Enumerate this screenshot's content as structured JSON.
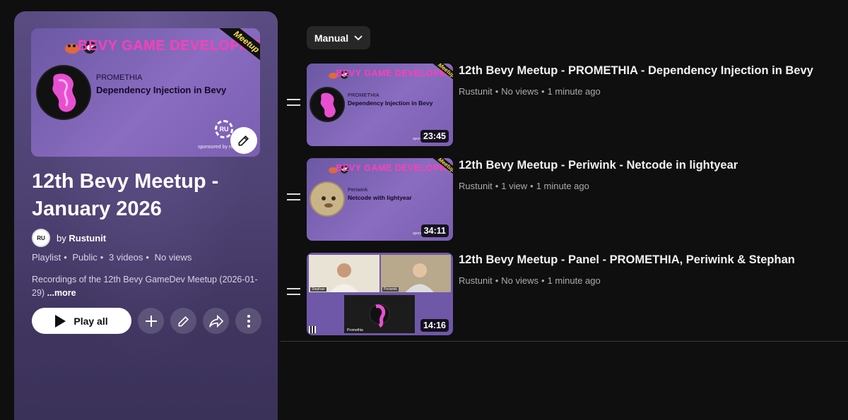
{
  "playlist": {
    "title": "12th Bevy Meetup - January 2026",
    "owner_prefix": "by",
    "owner_name": "Rustunit",
    "avatar_text": "RU",
    "meta": [
      "Playlist",
      "Public",
      "3 videos",
      "No views"
    ],
    "description": "Recordings of the 12th Bevy GameDev Meetup (2026-01-29)",
    "more_label": "...more",
    "play_all_label": "Play all",
    "hero": {
      "banner": "BEVY GAME DEVELOPMENT",
      "ribbon": "Meetup",
      "speaker": "PROMETHIA",
      "topic": "Dependency Injection in Bevy",
      "logo": "RU",
      "sponsor": "sponsored by rustunit"
    }
  },
  "sort": {
    "label": "Manual"
  },
  "videos": [
    {
      "title": "12th Bevy Meetup - PROMETHIA - Dependency Injection in Bevy",
      "channel": "Rustunit",
      "views": "No views",
      "age": "1 minute ago",
      "duration": "23:45",
      "thumb": {
        "banner": "BEVY GAME DEVELOPMENT",
        "ribbon": "Meetup",
        "speaker": "PROMETHIA",
        "topic": "Dependency Injection in Bevy",
        "sponsor": "sponsored by"
      }
    },
    {
      "title": "12th Bevy Meetup - Periwink - Netcode in lightyear",
      "channel": "Rustunit",
      "views": "1 view",
      "age": "1 minute ago",
      "duration": "34:11",
      "thumb": {
        "banner": "BEVY GAME DEVELOPMENT",
        "ribbon": "Meetup",
        "speaker": "Periwink",
        "topic": "Netcode with lightyear",
        "sponsor": "sponsored by"
      }
    },
    {
      "title": "12th Bevy Meetup - Panel - PROMETHIA, Periwink & Stephan",
      "channel": "Rustunit",
      "views": "No views",
      "age": "1 minute ago",
      "duration": "14:16",
      "thumb": {
        "tile1": "Stephan",
        "tile2": "Periwink",
        "tile3": "Promethia"
      }
    }
  ],
  "colors": {
    "accent_pink": "#ff3fb8",
    "panel_top": "#5a4c82",
    "background": "#0f0f0f"
  }
}
